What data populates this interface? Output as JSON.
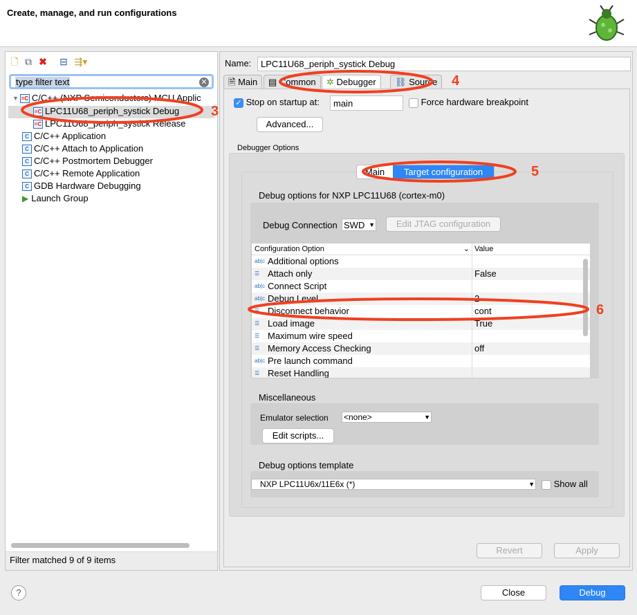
{
  "window": {
    "title": "Create, manage, and run configurations",
    "logo": "bug-icon"
  },
  "left": {
    "toolbar": [
      "new-config-icon",
      "duplicate-icon",
      "delete-icon",
      "collapse-all-icon",
      "filter-icon"
    ],
    "filter_placeholder": "type filter text",
    "tree": [
      {
        "label": "C/C++ (NXP Semiconductors) MCU Applic",
        "level": 0,
        "expanded": true
      },
      {
        "label": "LPC11U68_periph_systick Debug",
        "level": 1,
        "selected": true
      },
      {
        "label": "LPC11U68_periph_systick Release",
        "level": 1
      },
      {
        "label": "C/C++ Application",
        "level": 0
      },
      {
        "label": "C/C++ Attach to Application",
        "level": 0
      },
      {
        "label": "C/C++ Postmortem Debugger",
        "level": 0
      },
      {
        "label": "C/C++ Remote Application",
        "level": 0
      },
      {
        "label": "GDB Hardware Debugging",
        "level": 0
      },
      {
        "label": "Launch Group",
        "level": 0
      }
    ],
    "status": "Filter matched 9 of 9 items"
  },
  "right": {
    "name_label": "Name:",
    "name_value": "LPC11U68_periph_systick Debug",
    "tabs": [
      "Main",
      "Common",
      "Debugger",
      "Source"
    ],
    "active_tab": "Debugger",
    "stop_on_startup": {
      "label": "Stop on startup at:",
      "checked": true,
      "value": "main"
    },
    "force_hw_bp": {
      "label": "Force hardware breakpoint",
      "checked": false
    },
    "advanced": "Advanced...",
    "debugger_options_label": "Debugger Options",
    "subtabs": [
      "Main",
      "Target configuration"
    ],
    "active_subtab": "Target configuration",
    "debug_options_title": "Debug options for NXP LPC11U68 (cortex-m0)",
    "debug_connection_label": "Debug Connection",
    "debug_connection_value": "SWD",
    "edit_jtag": "Edit JTAG configuration",
    "table": {
      "headers": [
        "Configuration Option",
        "Value"
      ],
      "rows": [
        {
          "option": "Additional options",
          "value": "",
          "type": "text"
        },
        {
          "option": "Attach only",
          "value": "False",
          "type": "list"
        },
        {
          "option": "Connect Script",
          "value": "",
          "type": "text"
        },
        {
          "option": "Debug Level",
          "value": "2",
          "type": "text"
        },
        {
          "option": "Disconnect behavior",
          "value": "cont",
          "type": "list"
        },
        {
          "option": "Load image",
          "value": "True",
          "type": "list"
        },
        {
          "option": "Maximum wire speed",
          "value": "",
          "type": "list"
        },
        {
          "option": "Memory Access Checking",
          "value": "off",
          "type": "list"
        },
        {
          "option": "Pre launch command",
          "value": "",
          "type": "text"
        },
        {
          "option": "Reset Handling",
          "value": "",
          "type": "list"
        }
      ]
    },
    "misc_label": "Miscellaneous",
    "emulator_label": "Emulator selection",
    "emulator_value": "<none>",
    "edit_scripts": "Edit scripts...",
    "template_label": "Debug options template",
    "template_value": "NXP LPC11U6x/11E6x (*)",
    "show_all": "Show all",
    "revert": "Revert",
    "apply": "Apply"
  },
  "footer": {
    "help": "?",
    "close": "Close",
    "debug": "Debug"
  },
  "annotations": {
    "n3": "3",
    "n4": "4",
    "n5": "5",
    "n6": "6",
    "color": "#f04020"
  }
}
